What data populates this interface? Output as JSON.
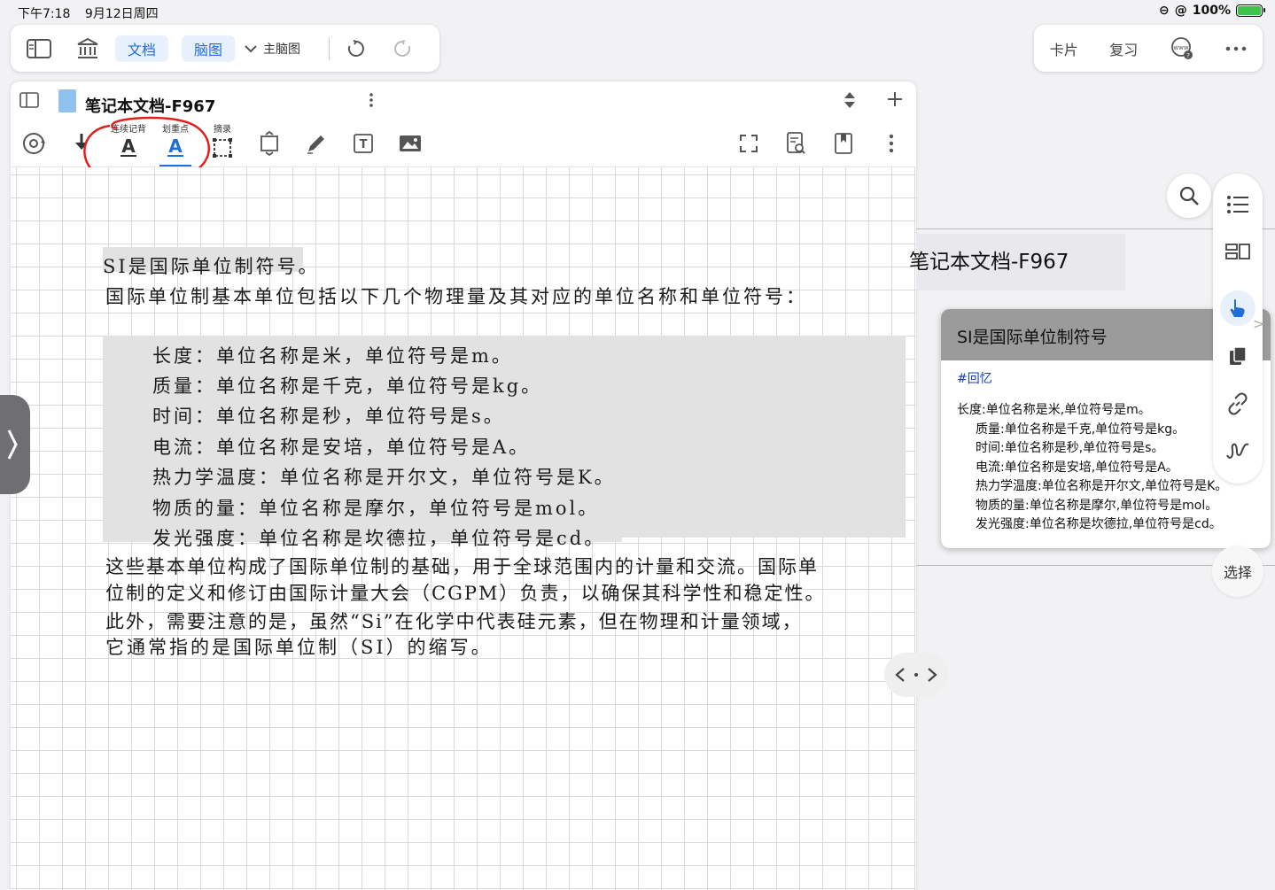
{
  "status_bar": {
    "time": "下午7:18",
    "date": "9月12日周四",
    "battery": "100%"
  },
  "top_toolbar": {
    "doc_tab": "文档",
    "mindmap_tab": "脑图",
    "main_mindmap": "主脑图"
  },
  "right_toolbar": {
    "cards": "卡片",
    "review": "复习"
  },
  "document": {
    "title": "笔记本文档-F967",
    "tools": {
      "continuous_recite": "连续记背",
      "highlight": "划重点",
      "excerpt": "摘录"
    },
    "lines": {
      "l1": "SI是国际单位制符号。",
      "l2": "国际单位制基本单位包括以下几个物理量及其对应的单位名称和单位符号：",
      "l3": "长度：单位名称是米，单位符号是m。",
      "l4": "质量：单位名称是千克，单位符号是kg。",
      "l5": "时间：单位名称是秒，单位符号是s。",
      "l6": "电流：单位名称是安培，单位符号是A。",
      "l7": "热力学温度：单位名称是开尔文，单位符号是K。",
      "l8": "物质的量：单位名称是摩尔，单位符号是mol。",
      "l9": "发光强度：单位名称是坎德拉，单位符号是cd。",
      "l10": "这些基本单位构成了国际单位制的基础，用于全球范围内的计量和交流。国际单",
      "l11": "位制的定义和修订由国际计量大会（CGPM）负责，以确保其科学性和稳定性。",
      "l12": "此外，需要注意的是，虽然“Si”在化学中代表硅元素，但在物理和计量领域，",
      "l13": "它通常指的是国际单位制（SI）的缩写。"
    }
  },
  "mindmap": {
    "title": "笔记本文档-F967",
    "card": {
      "title": "SI是国际单位制符号",
      "tag": "#回忆",
      "lines": {
        "b1": "长度:单位名称是米,单位符号是m。",
        "b2": "质量:单位名称是千克,单位符号是kg。",
        "b3": "时间:单位名称是秒,单位符号是s。",
        "b4": "电流:单位名称是安培,单位符号是A。",
        "b5": "热力学温度:单位名称是开尔文,单位符号是K。",
        "b6": "物质的量:单位名称是摩尔,单位符号是mol。",
        "b7": "发光强度:单位名称是坎德拉,单位符号是cd。"
      }
    },
    "select": "选择"
  },
  "colors": {
    "accent": "#1f6fd8",
    "highlight": "#e2e2e2",
    "annotation": "#e02020",
    "card_header": "#9b9b9b"
  },
  "icons": [
    "sidebar-icon",
    "library-icon",
    "undo-icon",
    "redo-icon",
    "www-help-icon",
    "more-icon",
    "search-icon",
    "list-icon",
    "layout-icon",
    "hand-pointer-icon",
    "copy-icon",
    "link-icon",
    "squiggle-icon"
  ]
}
